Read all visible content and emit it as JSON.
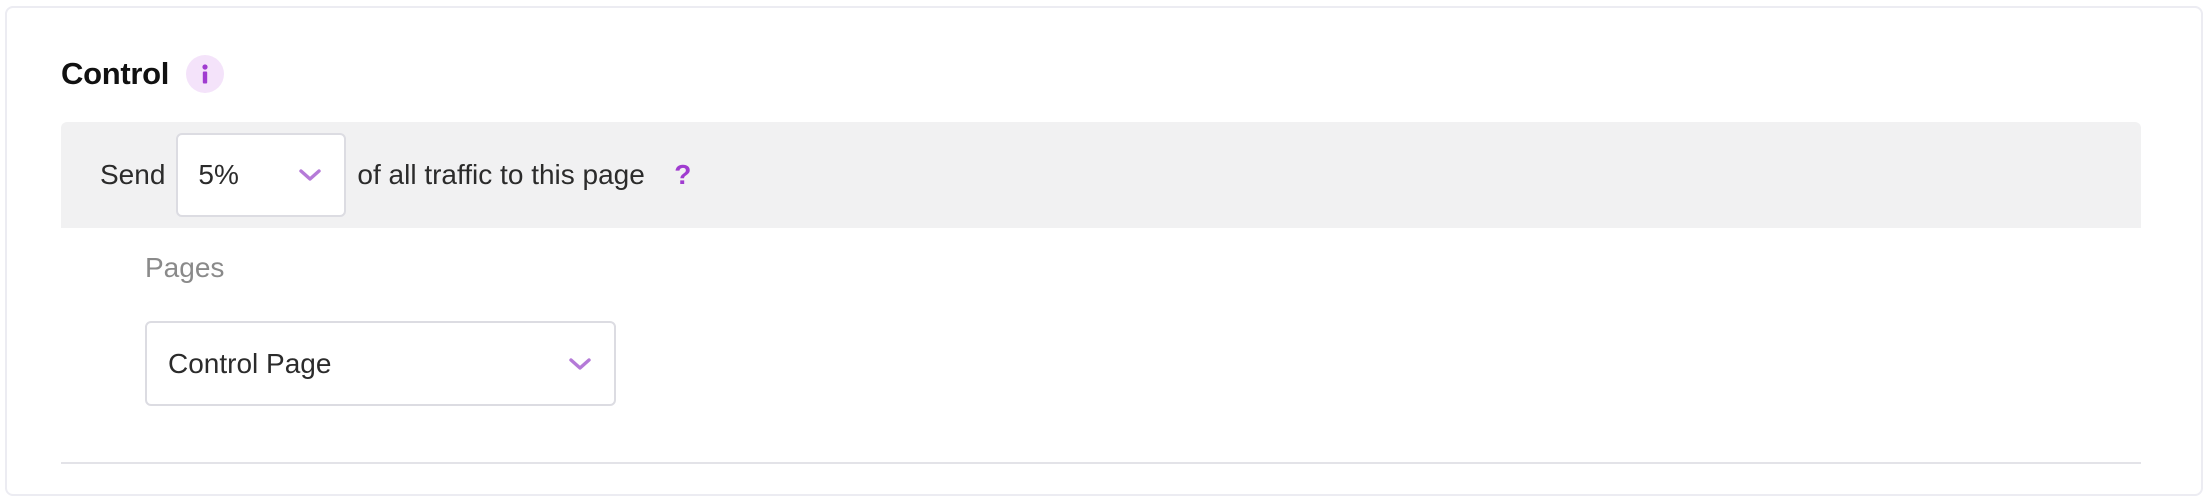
{
  "section": {
    "title": "Control",
    "info_icon": "info-icon"
  },
  "traffic": {
    "prefix": "Send",
    "selected_percent": "5%",
    "suffix": "of all traffic to this page",
    "help_icon": "question-mark-icon",
    "help_glyph": "?"
  },
  "pages": {
    "label": "Pages",
    "selected_page": "Control Page"
  },
  "colors": {
    "accent": "#a03cd0",
    "band_background": "#f1f1f2",
    "badge_background": "#f4e3fa",
    "chevron": "#b57ad8"
  }
}
